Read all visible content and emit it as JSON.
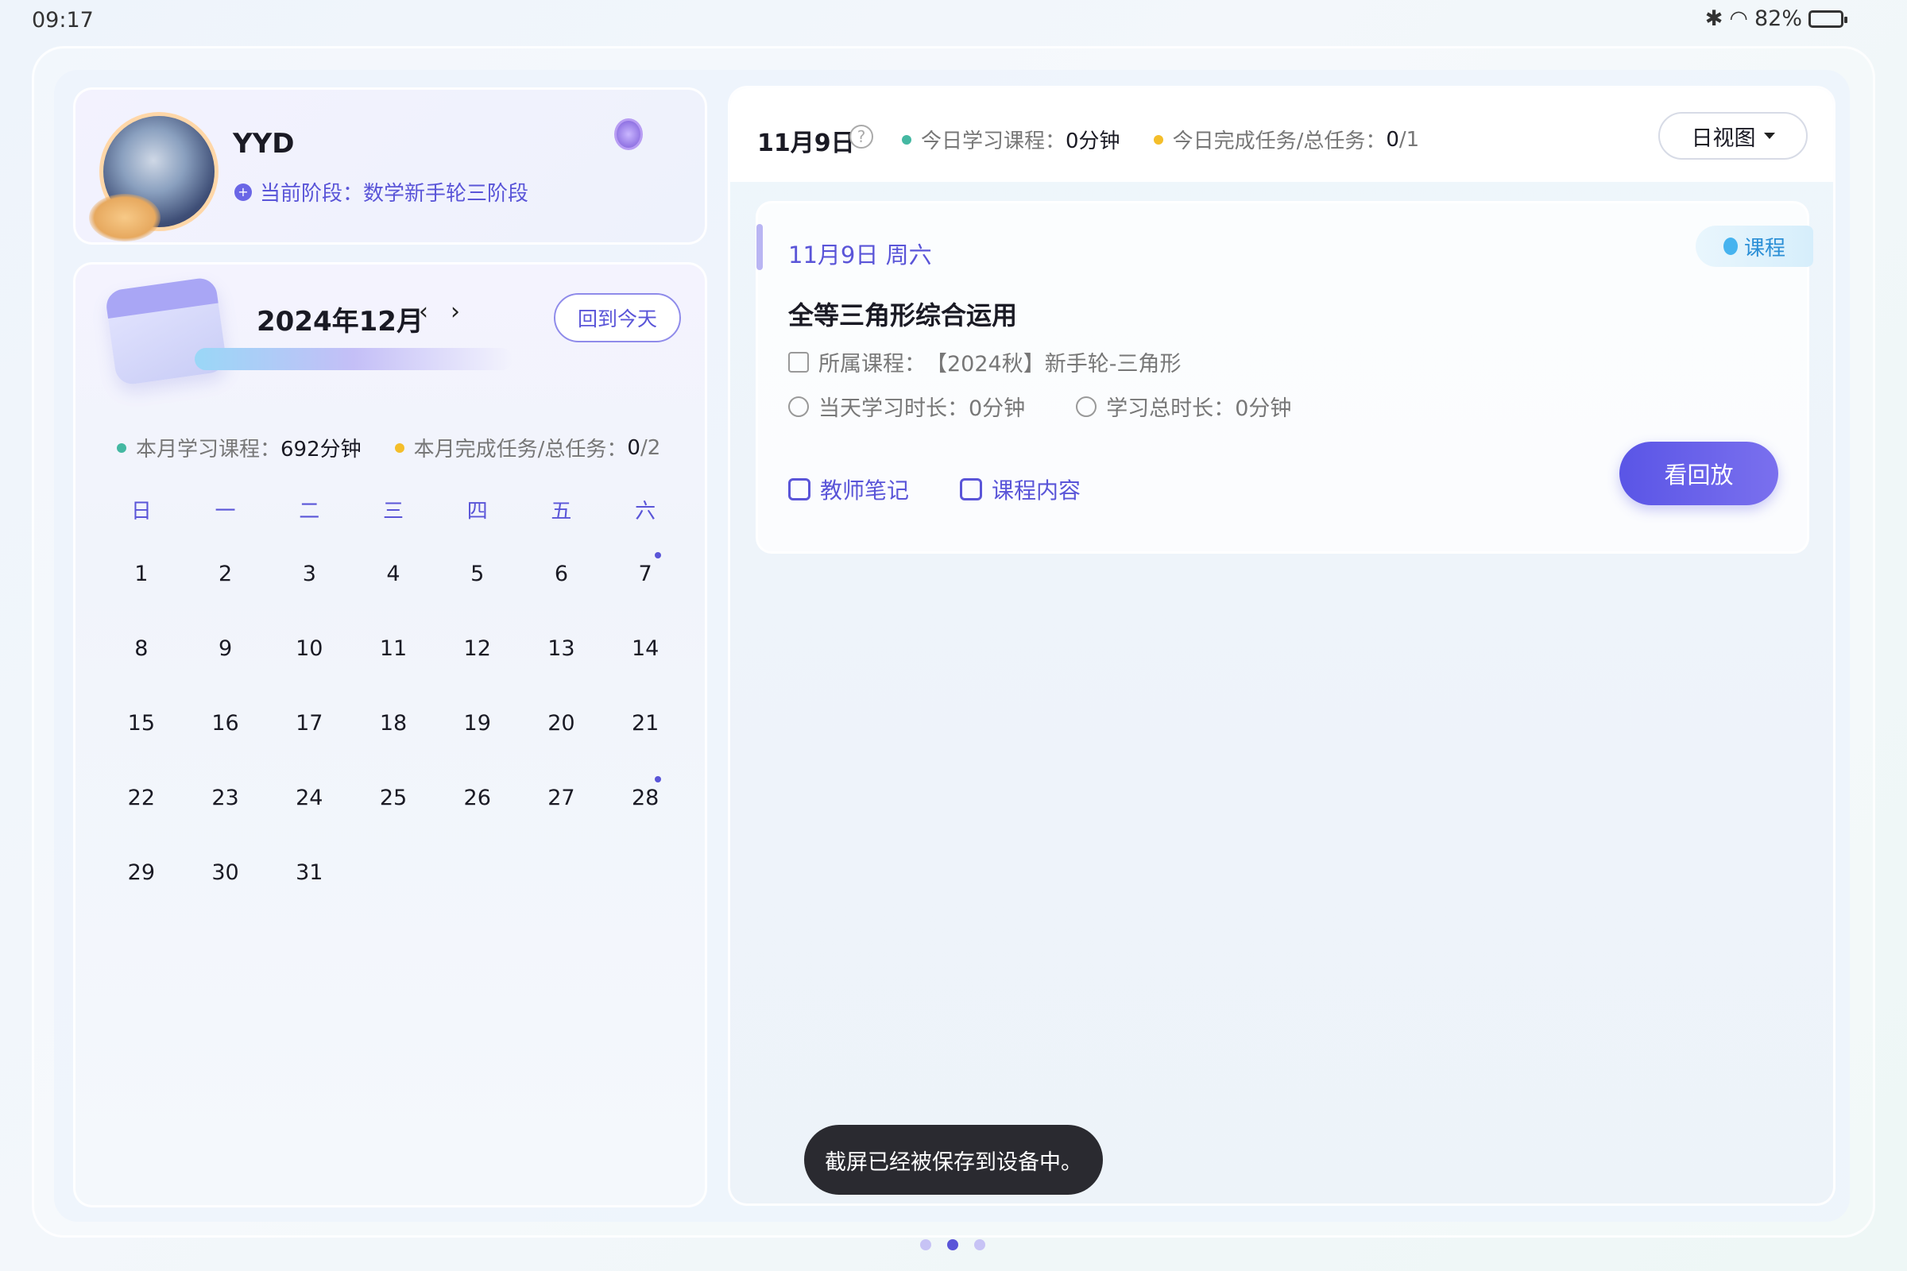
{
  "status_bar": {
    "time": "09:17",
    "battery": "82%",
    "battery_level": 0.82,
    "icons": [
      "bluetooth-icon",
      "wifi-icon",
      "battery-icon"
    ]
  },
  "profile": {
    "name": "YYD",
    "stage_label": "当前阶段：",
    "stage_value": "数学新手轮三阶段"
  },
  "calendar": {
    "month_title": "2024年12月",
    "prev": "‹",
    "next": "›",
    "today_button": "回到今天",
    "stats": {
      "study_label": "本月学习课程：",
      "study_value": "692分钟",
      "task_label": "本月完成任务/总任务：",
      "task_done": "0",
      "task_total": "/2"
    },
    "weekdays": [
      "日",
      "一",
      "二",
      "三",
      "四",
      "五",
      "六"
    ],
    "days": [
      "1",
      "2",
      "3",
      "4",
      "5",
      "6",
      "7",
      "8",
      "9",
      "10",
      "11",
      "12",
      "13",
      "14",
      "15",
      "16",
      "17",
      "18",
      "19",
      "20",
      "21",
      "22",
      "23",
      "24",
      "25",
      "26",
      "27",
      "28",
      "29",
      "30",
      "31"
    ],
    "marked_days": [
      "7",
      "28"
    ]
  },
  "day_view": {
    "date": "11月9日",
    "help": "?",
    "study_label": "今日学习课程：",
    "study_value": "0分钟",
    "task_label": "今日完成任务/总任务：",
    "task_done": "0",
    "task_total": "/1",
    "view_button": "日视图"
  },
  "lesson": {
    "date": "11月9日 周六",
    "tag": "课程",
    "title": "全等三角形综合运用",
    "course_label": "所属课程：",
    "course_value": "【2024秋】新手轮-三角形",
    "day_duration_label": "当天学习时长：",
    "day_duration_value": "0分钟",
    "total_duration_label": "学习总时长：",
    "total_duration_value": "0分钟",
    "teacher_notes": "教师笔记",
    "course_content": "课程内容",
    "replay_button": "看回放"
  },
  "toast": "截屏已经被保存到设备中。",
  "pager": {
    "count": 3,
    "active": 1
  },
  "colors": {
    "accent": "#5a55d8",
    "green_dot": "#44b8a2",
    "yellow_dot": "#f4be2a",
    "tag_blue": "#2b8fd6"
  }
}
